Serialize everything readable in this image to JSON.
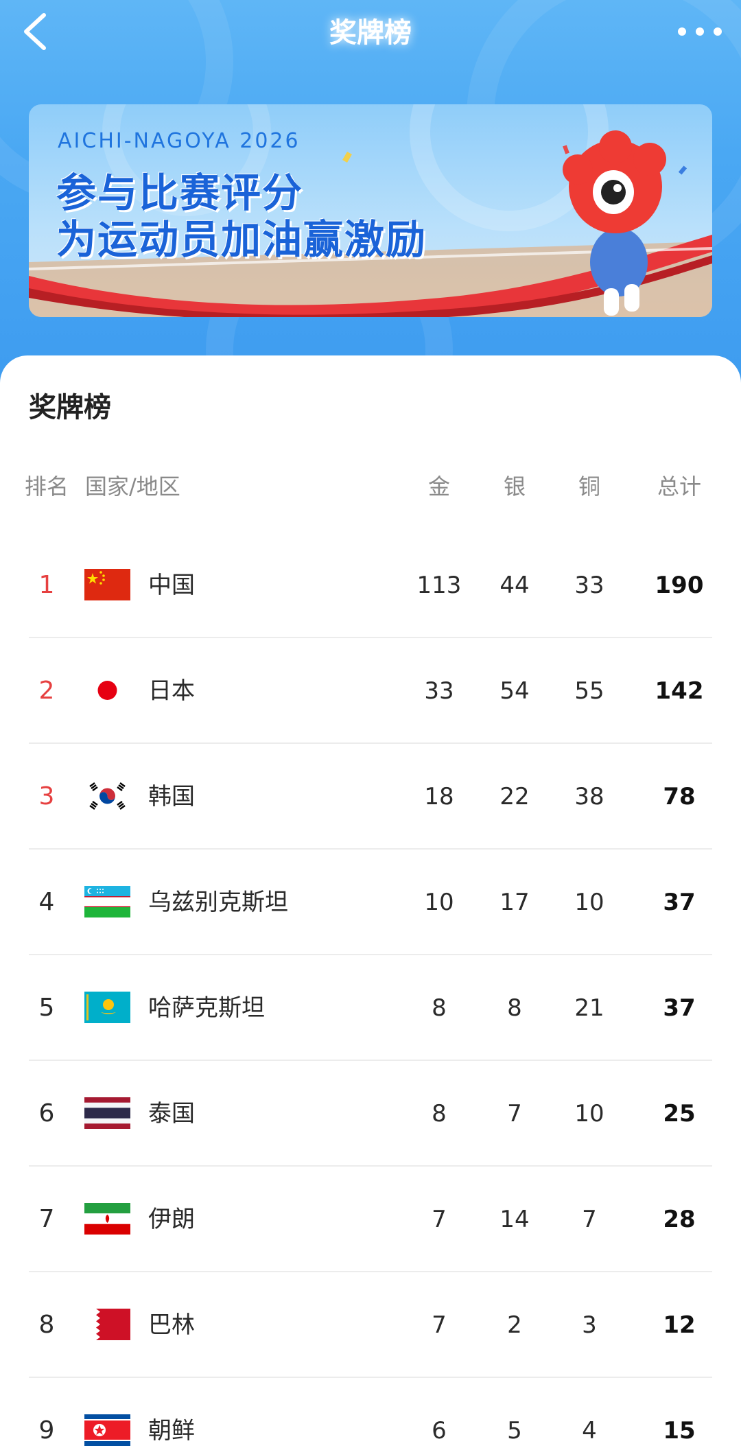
{
  "nav": {
    "title": "奖牌榜"
  },
  "banner": {
    "subtitle": "AICHI-NAGOYA 2026",
    "line1": "参与比赛评分",
    "line2": "为运动员加油赢激励"
  },
  "medal_table": {
    "title": "奖牌榜",
    "headers": {
      "rank": "排名",
      "country": "国家/地区",
      "gold": "金",
      "silver": "银",
      "bronze": "铜",
      "total": "总计"
    },
    "rows": [
      {
        "rank": "1",
        "country": "中国",
        "flag": "china-flag",
        "gold": "113",
        "silver": "44",
        "bronze": "33",
        "total": "190"
      },
      {
        "rank": "2",
        "country": "日本",
        "flag": "japan-flag",
        "gold": "33",
        "silver": "54",
        "bronze": "55",
        "total": "142"
      },
      {
        "rank": "3",
        "country": "韩国",
        "flag": "korea-flag",
        "gold": "18",
        "silver": "22",
        "bronze": "38",
        "total": "78"
      },
      {
        "rank": "4",
        "country": "乌兹别克斯坦",
        "flag": "uzbekistan-flag",
        "gold": "10",
        "silver": "17",
        "bronze": "10",
        "total": "37"
      },
      {
        "rank": "5",
        "country": "哈萨克斯坦",
        "flag": "kazakhstan-flag",
        "gold": "8",
        "silver": "8",
        "bronze": "21",
        "total": "37"
      },
      {
        "rank": "6",
        "country": "泰国",
        "flag": "thailand-flag",
        "gold": "8",
        "silver": "7",
        "bronze": "10",
        "total": "25"
      },
      {
        "rank": "7",
        "country": "伊朗",
        "flag": "iran-flag",
        "gold": "7",
        "silver": "14",
        "bronze": "7",
        "total": "28"
      },
      {
        "rank": "8",
        "country": "巴林",
        "flag": "bahrain-flag",
        "gold": "7",
        "silver": "2",
        "bronze": "3",
        "total": "12"
      },
      {
        "rank": "9",
        "country": "朝鲜",
        "flag": "north-korea-flag",
        "gold": "6",
        "silver": "5",
        "bronze": "4",
        "total": "15"
      }
    ]
  },
  "colors": {
    "header_blue": "#4aa8f3",
    "top3_rank": "#e64040",
    "divider": "#ececec"
  }
}
